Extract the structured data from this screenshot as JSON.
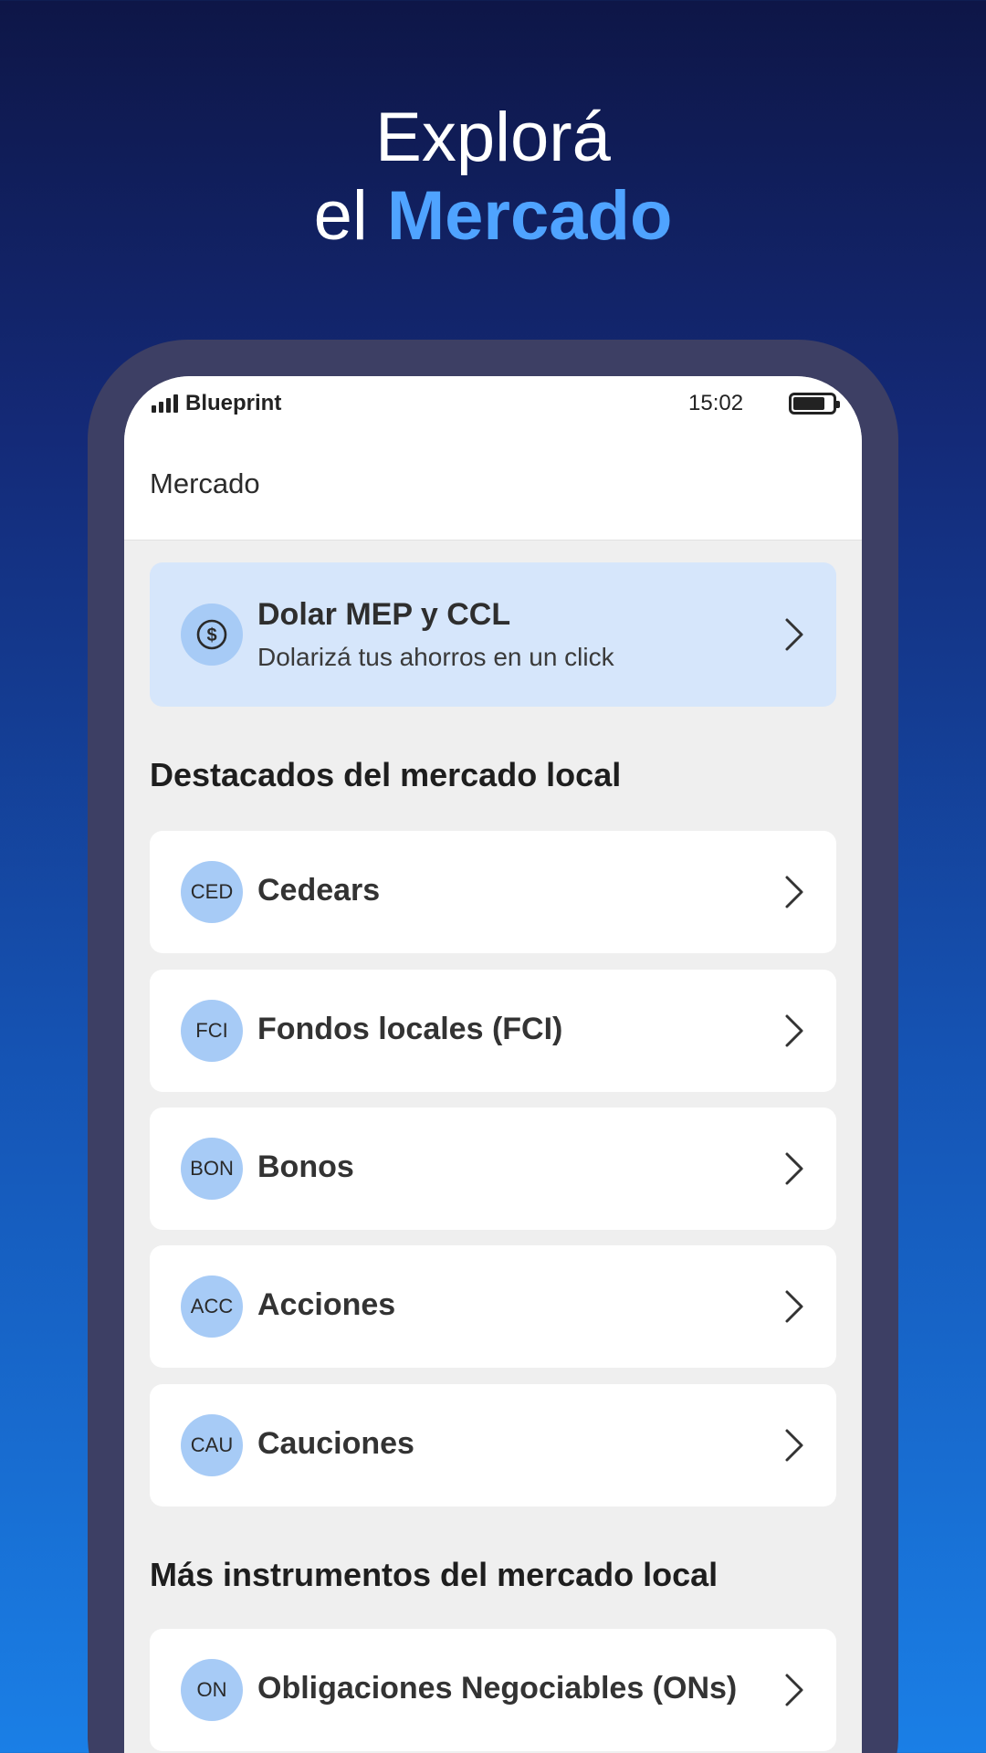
{
  "hero": {
    "line1": "Explorá",
    "line2_prefix": "el",
    "line2_accent": "Mercado"
  },
  "status_bar": {
    "carrier": "Blueprint",
    "time": "15:02"
  },
  "appbar": {
    "title": "Mercado"
  },
  "promo": {
    "icon": "dollar-icon",
    "title": "Dolar MEP y CCL",
    "subtitle": "Dolarizá tus ahorros en un click"
  },
  "highlights": {
    "title": "Destacados del mercado local",
    "items": [
      {
        "badge": "CED",
        "label": "Cedears"
      },
      {
        "badge": "FCI",
        "label": "Fondos locales (FCI)"
      },
      {
        "badge": "BON",
        "label": "Bonos"
      },
      {
        "badge": "ACC",
        "label": "Acciones"
      },
      {
        "badge": "CAU",
        "label": "Cauciones"
      }
    ]
  },
  "more": {
    "title": "Más instrumentos del mercado local",
    "items": [
      {
        "badge": "ON",
        "label": "Obligaciones Negociables (ONs)"
      }
    ]
  },
  "colors": {
    "accent": "#4fa3ff",
    "frame": "#3d3f64",
    "promo_bg": "#d6e6fb",
    "badge_bg": "#a7cbf6"
  }
}
